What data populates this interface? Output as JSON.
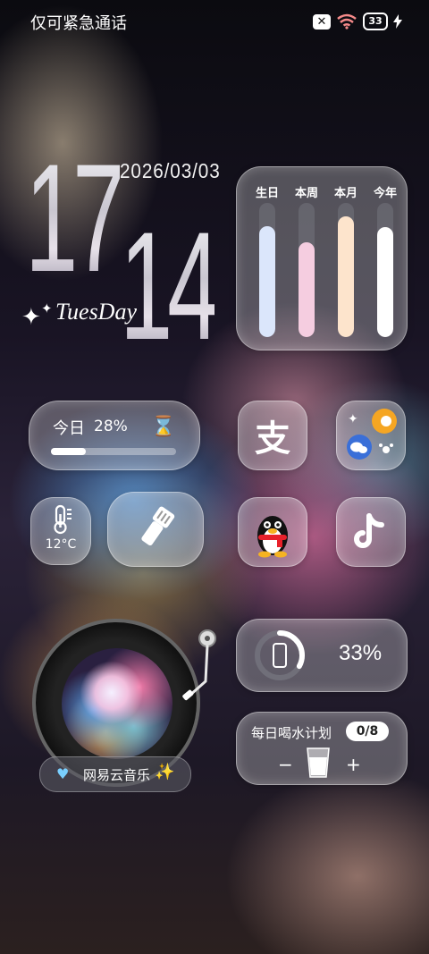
{
  "status_bar": {
    "left_text": "仅可紧急通话",
    "battery_level": "33"
  },
  "clock": {
    "hour": "17",
    "minute": "14",
    "date": "2026/03/03",
    "weekday": "TuesDay"
  },
  "progress_widget": {
    "items": [
      {
        "label": "生日",
        "fraction": 0.83,
        "color": "#dbe6fb"
      },
      {
        "label": "本周",
        "fraction": 0.71,
        "color": "#f5cde0"
      },
      {
        "label": "本月",
        "fraction": 0.9,
        "color": "#fde4cc"
      },
      {
        "label": "今年",
        "fraction": 0.82,
        "color": "#ffffff"
      }
    ]
  },
  "today_widget": {
    "label": "今日",
    "value": "28%",
    "fraction": 0.28
  },
  "temperature": {
    "value": "12°C"
  },
  "apps": {
    "alipay_glyph": "支"
  },
  "music": {
    "title": "网易云音乐"
  },
  "battery_widget": {
    "value": "33%",
    "fraction": 0.33
  },
  "water_widget": {
    "title": "每日喝水计划",
    "count": "0/8",
    "minus": "−",
    "plus": "+"
  }
}
